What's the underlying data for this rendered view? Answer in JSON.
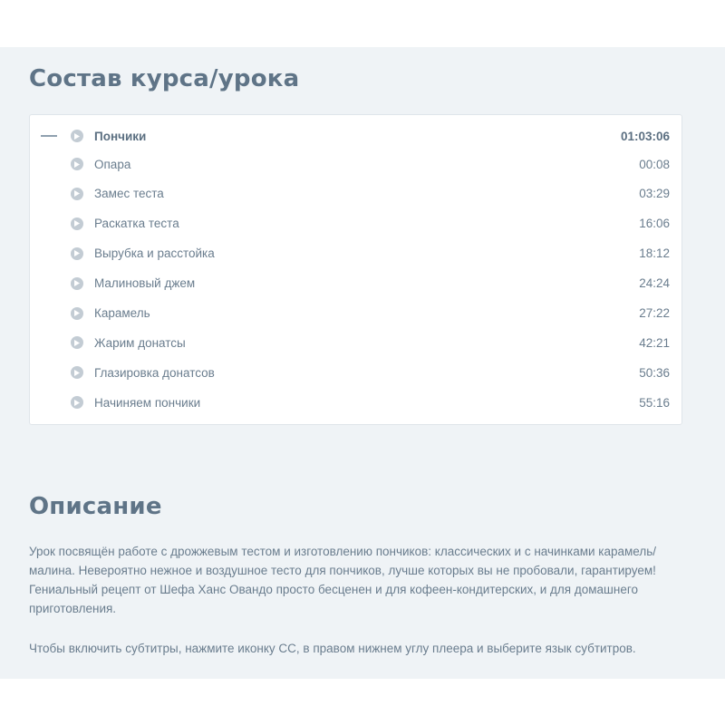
{
  "course": {
    "title": "Состав курса/урока",
    "module": {
      "label": "Пончики",
      "duration": "01:03:06"
    },
    "lessons": [
      {
        "label": "Опара",
        "time": "00:08"
      },
      {
        "label": "Замес теста",
        "time": "03:29"
      },
      {
        "label": "Раскатка теста",
        "time": "16:06"
      },
      {
        "label": "Вырубка и расстойка",
        "time": "18:12"
      },
      {
        "label": "Малиновый джем",
        "time": "24:24"
      },
      {
        "label": "Карамель",
        "time": "27:22"
      },
      {
        "label": "Жарим донатсы",
        "time": "42:21"
      },
      {
        "label": "Глазировка донатсов",
        "time": "50:36"
      },
      {
        "label": "Начиняем пончики",
        "time": "55:16"
      }
    ]
  },
  "description": {
    "title": "Описание",
    "paragraph_1": "Урок посвящён работе с дрожжевым тестом и изготовлению пончиков: классических и с начинками карамель/малина. Невероятно нежное и воздушное тесто для пончиков, лучше которых вы не пробовали, гарантируем! Гениальный рецепт от Шефа Ханс Овандо просто бесценен и для кофеен-кондитерских, и для домашнего приготовления.",
    "paragraph_2": "Чтобы включить субтитры, нажмите иконку СС, в правом нижнем углу плеера и выберите язык субтитров."
  },
  "colors": {
    "panel_bg": "#eff3f6",
    "heading": "#5f7487",
    "text": "#6a7d8e",
    "play_icon": "#c3ccd4"
  },
  "icons": {
    "collapse": "minus-icon",
    "lesson": "play-circle-icon"
  }
}
